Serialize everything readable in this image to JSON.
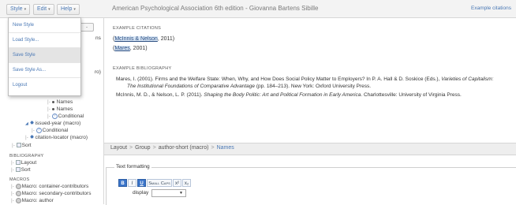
{
  "menubar": {
    "style_label": "Style",
    "edit_label": "Edit",
    "help_label": "Help",
    "caret": "▾"
  },
  "app_title": "American Psychological Association 6th edition - Giovanna Bartens Sibille",
  "example_link": "Example citations",
  "style_menu": {
    "items": [
      "New Style",
      "Load Style...",
      "Save Style",
      "Save Style As...",
      "Logout"
    ],
    "active_index": 2
  },
  "left_tree": {
    "partial_ns": "ns",
    "partial_ro": "ro)",
    "names_1": "Names",
    "names_2": "Names",
    "conditional_1": "Conditional",
    "issued_year": "issued-year (macro)",
    "conditional_2": "Conditional",
    "citation_locator": "citation-locator (macro)",
    "sort_1": "Sort",
    "bibliography_head": "BIBLIOGRAPHY",
    "layout": "Layout",
    "sort_2": "Sort",
    "macros_head": "MACROS",
    "macro_1": "Macro: container-contributors",
    "macro_2": "Macro: secondary-contributors",
    "macro_3": "Macro: author"
  },
  "citations": {
    "label": "EXAMPLE CITATIONS",
    "c1_open": "(",
    "c1_hl": "McInnis & Nelson",
    "c1_rest": ", 2011)",
    "c2_open": "(",
    "c2_hl": "Mares",
    "c2_rest": ", 2001)"
  },
  "bibliography": {
    "label": "EXAMPLE BIBLIOGRAPHY",
    "e1_a": "Mares, I. (2001). Firms and the Welfare State: When, Why, and How Does Social Policy Matter to Employers? In P. A. Hall & D. Soskice (Eds.),",
    "e1_italic": "Varieties of Capitalism:",
    "e1_b_italic": "The Institutional Foundations of Comparative Advantage",
    "e1_b_rest": "(pp. 184–213). New York: Oxford University Press.",
    "e2_a": "McInnis, M. D., & Nelson, L. P. (2011).",
    "e2_italic": "Shaping the Body Politic: Art and Political Formation in Early America",
    "e2_rest": ". Charlottesville: University of Virginia Press."
  },
  "breadcrumb": [
    "Layout",
    "Group",
    "author-short (macro)",
    "Names"
  ],
  "breadcrumb_sep": ">",
  "text_formatting": {
    "legend": "Text formatting",
    "buttons": [
      "B",
      "I",
      "U",
      "Small Caps",
      "x²",
      "x₂"
    ],
    "display_label": "display",
    "display_value": "",
    "select_caret": "▼"
  },
  "colors": {
    "accent": "#4a78b5",
    "highlight": "#d8e6f5",
    "active_button": "#3a74c9"
  }
}
